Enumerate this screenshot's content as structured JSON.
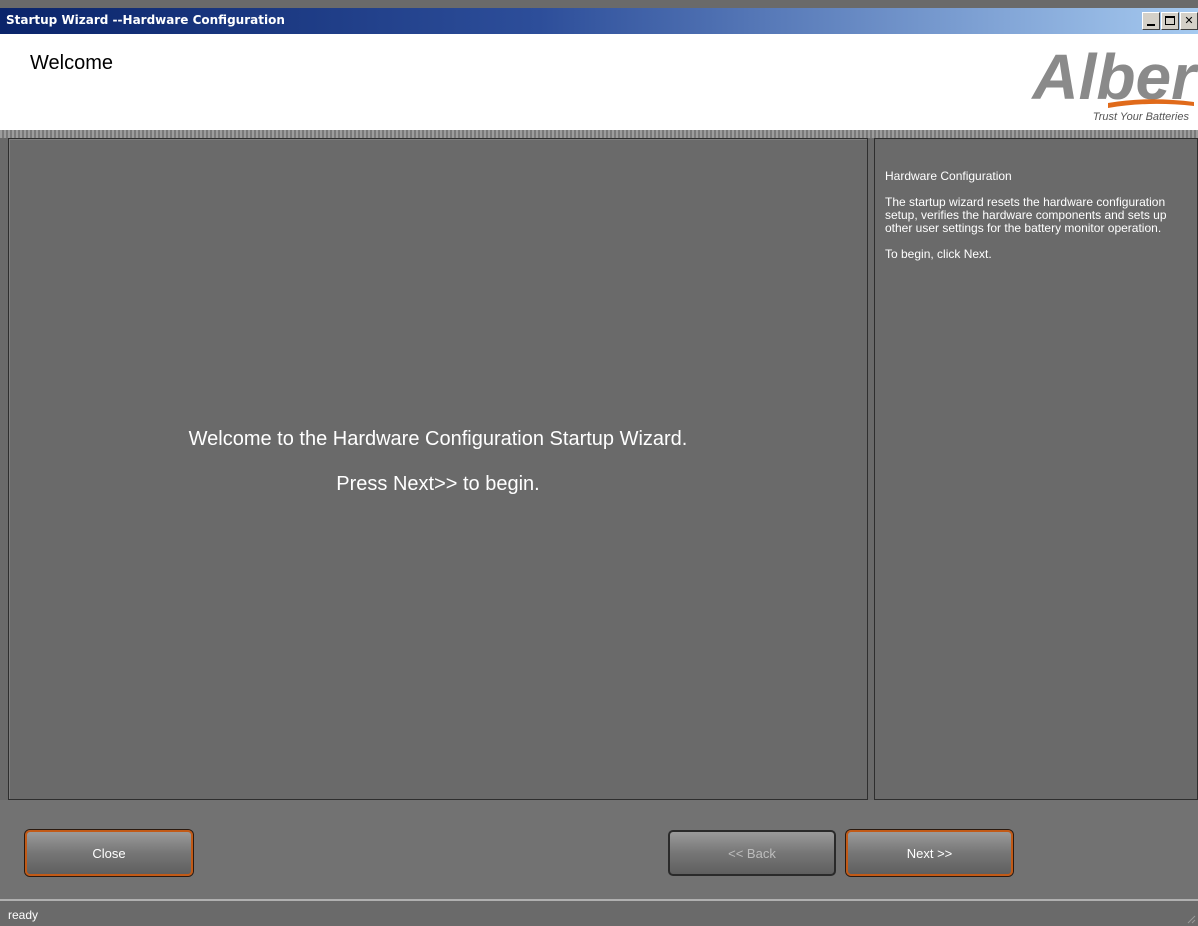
{
  "window": {
    "title": "Startup Wizard --Hardware Configuration",
    "controls": {
      "minimize": "_",
      "maximize": "□",
      "close": "✕"
    }
  },
  "header": {
    "title": "Welcome",
    "logo": {
      "brand": "Alber",
      "tagline": "Trust Your Batteries"
    }
  },
  "main": {
    "line1": "Welcome to the Hardware Configuration Startup Wizard.",
    "line2": "Press Next>> to begin."
  },
  "info": {
    "heading": "Hardware Configuration",
    "body": "The startup wizard resets the hardware configuration setup, verifies the hardware components and sets up other user settings for the battery monitor operation.",
    "instruction": "To begin, click Next."
  },
  "buttons": {
    "close": "Close",
    "back": "<< Back",
    "next": "Next >>"
  },
  "status": {
    "text": "ready"
  },
  "colors": {
    "panel": "#6a6a6a",
    "button_border_active": "#c25a17",
    "logo_gray": "#8a8a8a",
    "logo_orange": "#e06a1a"
  }
}
